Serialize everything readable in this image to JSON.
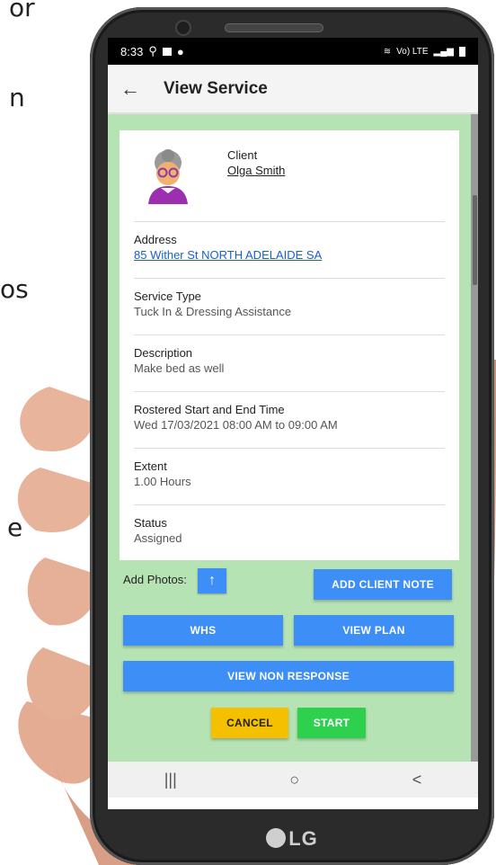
{
  "background_fragments": {
    "frag1": "or",
    "frag2": "n",
    "frag3": "os",
    "frag4": "e"
  },
  "phone": {
    "brand": "LG"
  },
  "statusbar": {
    "time": "8:33",
    "network": "Vo) LTE"
  },
  "appbar": {
    "back_icon": "arrow-left-icon",
    "title": "View Service"
  },
  "client": {
    "label": "Client",
    "name": "Olga Smith"
  },
  "fields": [
    {
      "label": "Address",
      "value": "85 Wither St NORTH ADELAIDE SA"
    },
    {
      "label": "Service Type",
      "value": "Tuck In & Dressing Assistance"
    },
    {
      "label": "Description",
      "value": "Make bed as well"
    },
    {
      "label": "Rostered Start and End Time",
      "value": "Wed 17/03/2021 08:00 AM to 09:00 AM"
    },
    {
      "label": "Extent",
      "value": "1.00 Hours"
    },
    {
      "label": "Status",
      "value": "Assigned"
    }
  ],
  "actions": {
    "add_photos_label": "Add Photos:",
    "upload_icon": "↑",
    "add_client_note": "ADD CLIENT NOTE",
    "whs": "WHS",
    "view_plan": "VIEW PLAN",
    "view_non_response": "VIEW NON RESPONSE",
    "cancel": "CANCEL",
    "start": "START"
  },
  "navbar": {
    "recents": "|||",
    "home": "○",
    "back": "<"
  },
  "colors": {
    "content_bg": "#b6e3b4",
    "primary_button": "#3e8ef7",
    "cancel_button": "#f5c000",
    "start_button": "#2dd14e",
    "link": "#1a5fd0"
  }
}
